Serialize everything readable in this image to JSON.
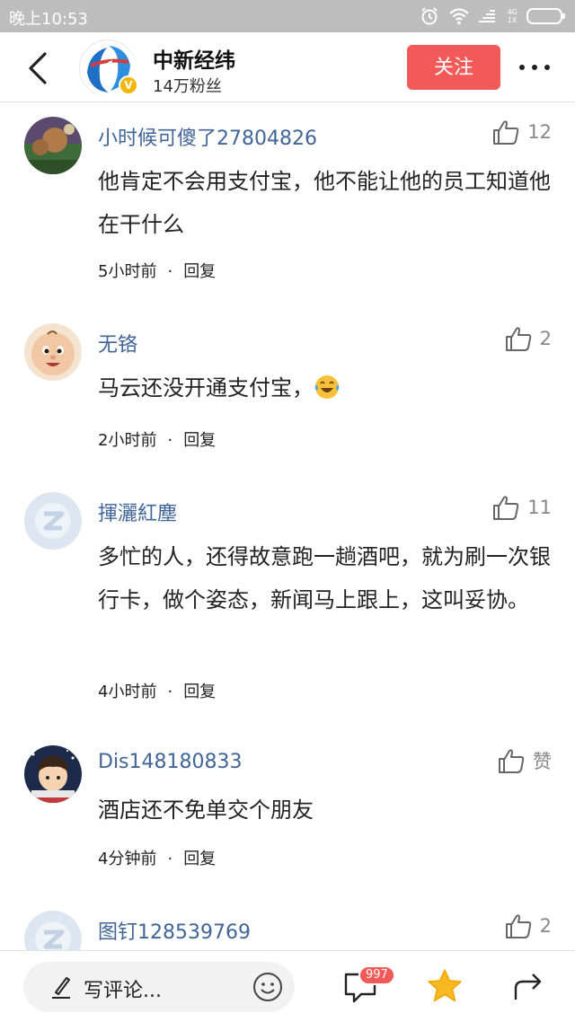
{
  "status_bar": {
    "time": "晚上10:53",
    "net_top": "4G",
    "net_bottom": "1X"
  },
  "header": {
    "account_name": "中新经纬",
    "followers": "14万粉丝",
    "follow_label": "关注",
    "verified_mark": "V"
  },
  "comments": [
    {
      "username": "小时候可傻了27804826",
      "likes": "12",
      "text": "他肯定不会用支付宝，他不能让他的员工知道他在干什么",
      "time": "5小时前",
      "separator": "·",
      "reply_label": "回复",
      "avatar_icon": "photo-avatar"
    },
    {
      "username": "无铬",
      "likes": "2",
      "text": "马云还没开通支付宝，",
      "has_emoji": true,
      "emoji_icon": "laughing-tears-emoji",
      "time": "2小时前",
      "separator": "·",
      "reply_label": "回复",
      "avatar_icon": "baby-face-avatar"
    },
    {
      "username": "揮灑紅塵",
      "likes": "11",
      "text": "多忙的人，还得故意跑一趟酒吧，就为刷一次银行卡，做个姿态，新闻马上跟上，这叫妥协。",
      "time": "4小时前",
      "separator": "·",
      "reply_label": "回复",
      "avatar_icon": "default-z-avatar"
    },
    {
      "username": "Dis148180833",
      "likes": "赞",
      "text": "酒店还不免单交个朋友",
      "time": "4分钟前",
      "separator": "·",
      "reply_label": "回复",
      "avatar_icon": "cartoon-boy-avatar"
    },
    {
      "username": "图钉128539769",
      "likes": "2",
      "avatar_icon": "default-z-avatar"
    }
  ],
  "bottom_bar": {
    "input_placeholder": "写评论...",
    "comment_count": "997"
  },
  "colors": {
    "accent_red": "#f25a5a",
    "username_blue": "#406599",
    "star_yellow": "#f7b820",
    "status_bar_gray": "#bdbdbd"
  }
}
